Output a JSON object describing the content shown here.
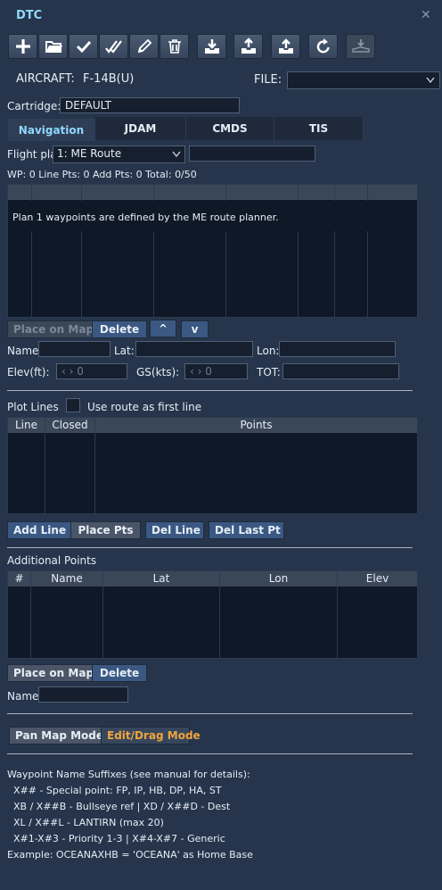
{
  "window": {
    "title": "DTC",
    "close_icon": "close-icon"
  },
  "toolbar": {
    "buttons": [
      {
        "name": "add-button",
        "icon": "plus-icon"
      },
      {
        "name": "open-button",
        "icon": "folder-icon"
      },
      {
        "name": "apply-button",
        "icon": "check-icon"
      },
      {
        "name": "apply-all-button",
        "icon": "double-check-icon"
      },
      {
        "name": "edit-button",
        "icon": "pencil-icon"
      },
      {
        "name": "delete-button",
        "icon": "trash-icon"
      },
      {
        "name": "download-button",
        "icon": "download-icon"
      },
      {
        "name": "upload-button",
        "icon": "upload-icon"
      },
      {
        "name": "reset-button",
        "icon": "refresh-icon"
      },
      {
        "name": "load-to-jet-button",
        "icon": "aircraft-load-icon",
        "disabled": true
      }
    ]
  },
  "aircraft": {
    "label": "AIRCRAFT:",
    "value": "F-14B(U)"
  },
  "file": {
    "label": "FILE:",
    "value": ""
  },
  "cartridge": {
    "label": "Cartridge:",
    "value": "DEFAULT"
  },
  "tabs": [
    {
      "label": "Navigation",
      "active": true
    },
    {
      "label": "JDAM",
      "active": false
    },
    {
      "label": "CMDS",
      "active": false
    },
    {
      "label": "TIS",
      "active": false
    }
  ],
  "flight_plan": {
    "label": "Flight pla",
    "selected": "1: ME Route",
    "name_value": ""
  },
  "counts": "WP: 0  Line Pts: 0  Add Pts: 0  Total: 0/50",
  "waypoints_grid": {
    "message": "Plan 1 waypoints are defined by the ME route planner."
  },
  "wp_buttons": {
    "place": "Place on Map",
    "delete": "Delete",
    "up": "^",
    "down": "v"
  },
  "wp_fields": {
    "name_label": "Name:",
    "lat_label": "Lat:",
    "lon_label": "Lon:",
    "elev_label": "Elev(ft):",
    "elev_value": "0",
    "gs_label": "GS(kts):",
    "gs_value": "0",
    "tot_label": "TOT:"
  },
  "plot_lines": {
    "label": "Plot Lines",
    "checkbox_label": "Use route as first line",
    "columns": [
      "Line",
      "Closed",
      "Points"
    ],
    "buttons": {
      "add": "Add Line",
      "place": "Place Pts",
      "del_line": "Del Line",
      "del_last": "Del Last Pt"
    }
  },
  "additional_points": {
    "label": "Additional Points",
    "columns": [
      "#",
      "Name",
      "Lat",
      "Lon",
      "Elev"
    ],
    "buttons": {
      "place": "Place on Map",
      "delete": "Delete"
    },
    "name_label": "Name:"
  },
  "modes": {
    "pan": "Pan Map Mode",
    "edit": "Edit/Drag Mode"
  },
  "notes": {
    "header": "Waypoint Name Suffixes (see manual for details):",
    "lines": [
      "X## - Special point: FP, IP, HB, DP, HA, ST",
      "XB / X##B - Bullseye ref  |  XD / X##D - Dest",
      "XL / X##L - LANTIRN (max 20)",
      "X#1-X#3 - Priority 1-3  |  X#4-X#7 - Generic"
    ],
    "example": "Example: OCEANAXHB = 'OCEANA' as Home Base"
  },
  "colors": {
    "accent": "#8fd8ff",
    "edit_mode": "#f0a53c",
    "button_blue": "#3a5882",
    "background": "#26354b"
  }
}
